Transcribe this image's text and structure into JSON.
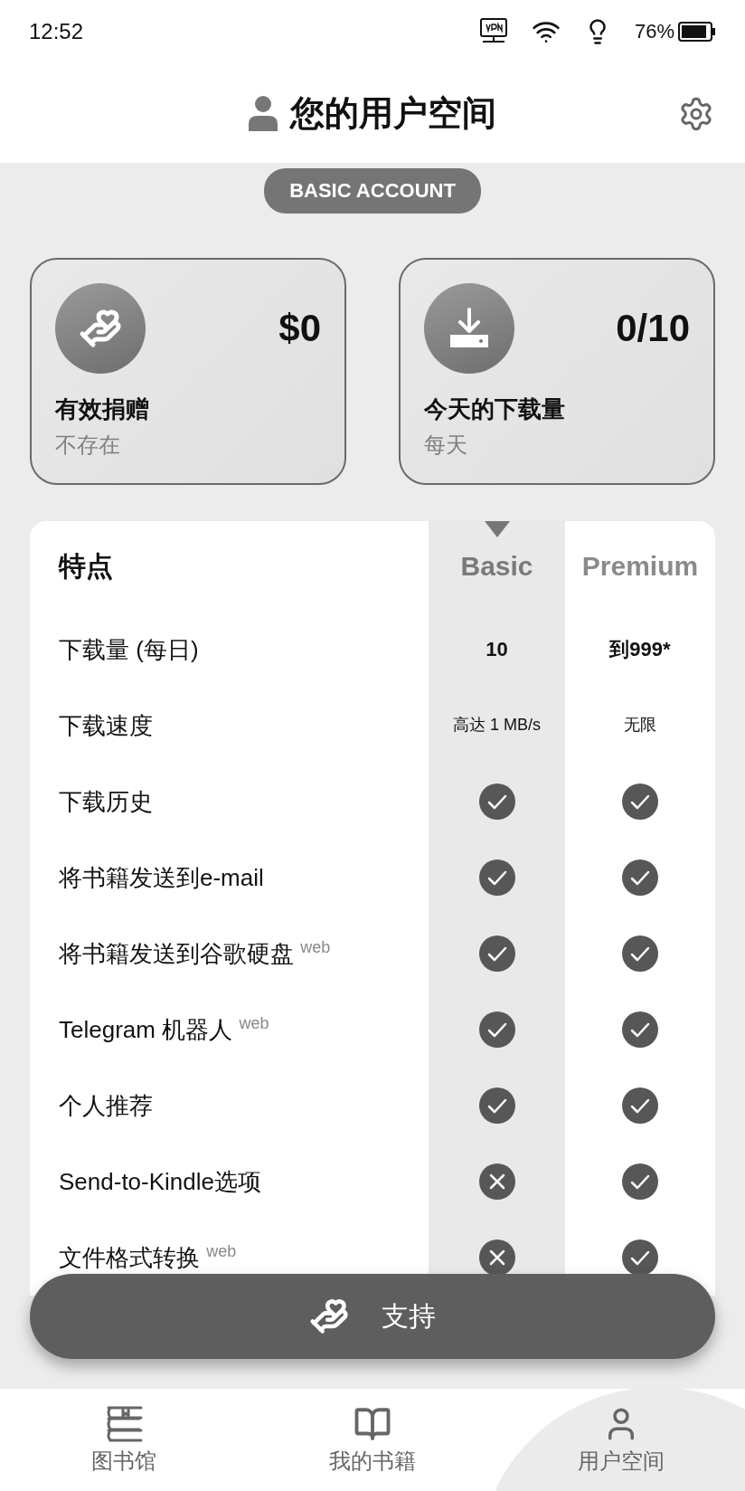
{
  "status_bar": {
    "time": "12:52",
    "battery": "76%"
  },
  "header": {
    "title": "您的用户空间"
  },
  "account_badge": "BASIC ACCOUNT",
  "stats": [
    {
      "kind": "donation",
      "value": "$0",
      "label": "有效捐赠",
      "sublabel": "不存在"
    },
    {
      "kind": "download",
      "value": "0/10",
      "label": "今天的下载量",
      "sublabel": "每天"
    }
  ],
  "features_table": {
    "columns": [
      {
        "label": "特点"
      },
      {
        "label": "Basic",
        "selected": true
      },
      {
        "label": "Premium",
        "selected": false
      }
    ],
    "rows": [
      {
        "feature": "下载量 (每日)",
        "basic": {
          "kind": "bold",
          "text": "10"
        },
        "premium": {
          "kind": "bold",
          "text": "到999*"
        }
      },
      {
        "feature": "下载速度",
        "basic": {
          "kind": "text",
          "text": "高达 1 MB/s"
        },
        "premium": {
          "kind": "text",
          "text": "无限"
        }
      },
      {
        "feature": "下载历史",
        "basic": {
          "kind": "check"
        },
        "premium": {
          "kind": "check"
        }
      },
      {
        "feature": "将书籍发送到e-mail",
        "basic": {
          "kind": "check"
        },
        "premium": {
          "kind": "check"
        }
      },
      {
        "feature": "将书籍发送到谷歌硬盘 $^{web}$",
        "basic": {
          "kind": "check"
        },
        "premium": {
          "kind": "check"
        }
      },
      {
        "feature": "Telegram 机器人 $^{web}$",
        "basic": {
          "kind": "check"
        },
        "premium": {
          "kind": "check"
        }
      },
      {
        "feature": "个人推荐",
        "basic": {
          "kind": "check"
        },
        "premium": {
          "kind": "check"
        }
      },
      {
        "feature": "Send-to-Kindle选项",
        "basic": {
          "kind": "cross"
        },
        "premium": {
          "kind": "check"
        }
      },
      {
        "feature": "文件格式转换 $^{web}$",
        "basic": {
          "kind": "cross"
        },
        "premium": {
          "kind": "check"
        }
      }
    ]
  },
  "support_button": "支持",
  "bottom_nav": [
    {
      "label": "图书馆",
      "kind": "library",
      "selected": false
    },
    {
      "label": "我的书籍",
      "kind": "book",
      "selected": false
    },
    {
      "label": "用户空间",
      "kind": "user",
      "selected": true
    }
  ]
}
